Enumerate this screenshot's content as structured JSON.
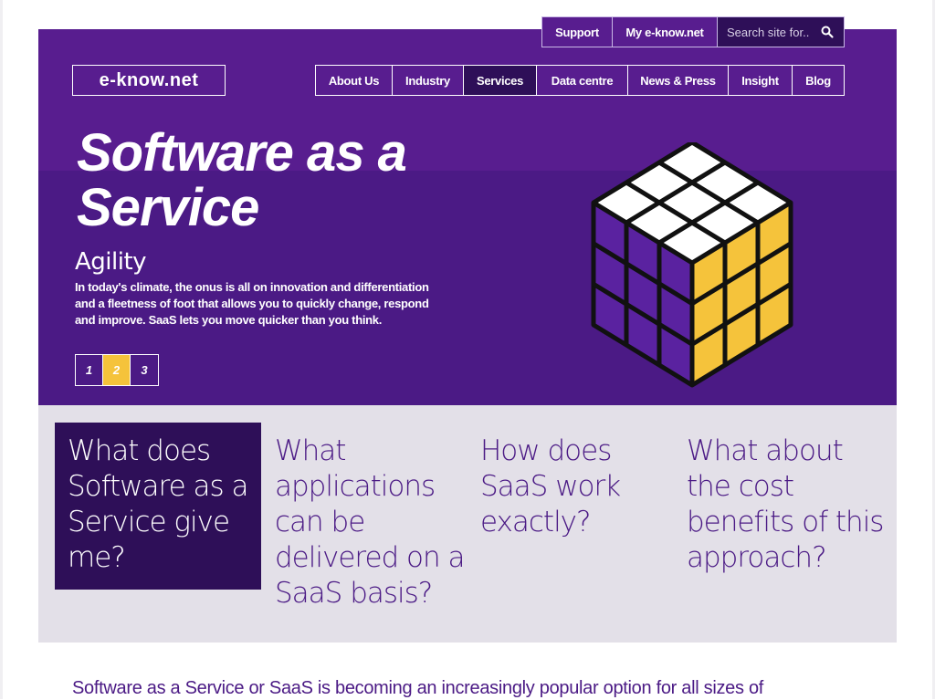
{
  "utility": {
    "support_label": "Support",
    "my_account_label": "My e-know.net",
    "search_placeholder": "Search site for..",
    "search_icon": "search-icon"
  },
  "logo": {
    "text": "e-know.net"
  },
  "nav": {
    "items": [
      {
        "label": "About Us"
      },
      {
        "label": "Industry"
      },
      {
        "label": "Services",
        "active": true
      },
      {
        "label": "Data centre"
      },
      {
        "label": "News & Press"
      },
      {
        "label": "Insight"
      },
      {
        "label": "Blog"
      }
    ]
  },
  "hero": {
    "title": "Software as a Service",
    "subtitle": "Agility",
    "body": "In today's climate, the onus is all on innovation and differentiation and a fleetness of foot that allows you to quickly change, respond and improve. SaaS lets you move quicker than you think.",
    "slides": [
      "1",
      "2",
      "3"
    ],
    "active_slide": "2"
  },
  "faq": {
    "items": [
      {
        "label": "What does Software as a Service give me?",
        "active": true
      },
      {
        "label": "What applications can be delivered on a SaaS basis?"
      },
      {
        "label": "How does SaaS work exactly?"
      },
      {
        "label": "What about the cost benefits of this approach?"
      }
    ]
  },
  "intro": {
    "text": "Software as a Service or SaaS is becoming an increasingly popular option for all sizes of"
  },
  "colors": {
    "purple": "#4b1a85",
    "purple_light": "#581d8f",
    "purple_dark": "#2e0f58",
    "accent_yellow": "#f5c33b",
    "faq_background": "#e3e0e8"
  }
}
